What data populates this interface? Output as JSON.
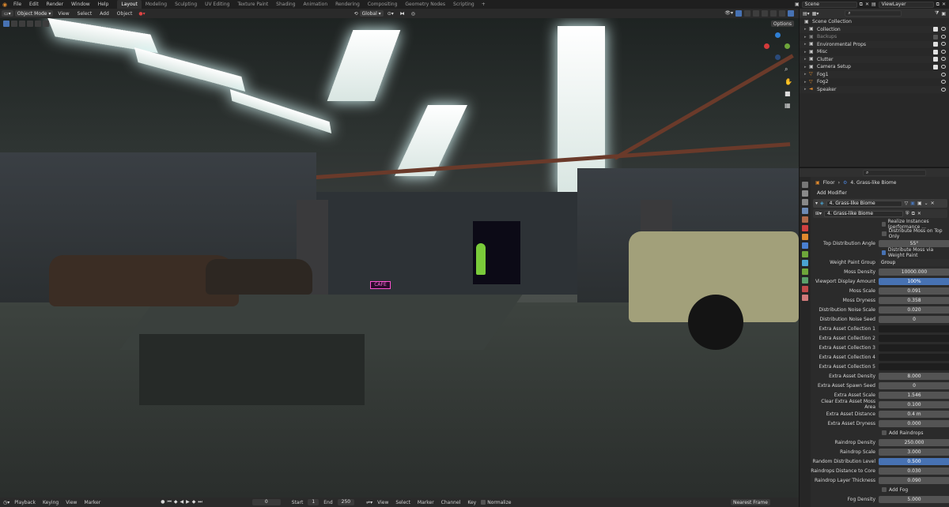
{
  "menu": {
    "items": [
      "File",
      "Edit",
      "Render",
      "Window",
      "Help"
    ],
    "workspaces": [
      "Layout",
      "Modeling",
      "Sculpting",
      "UV Editing",
      "Texture Paint",
      "Shading",
      "Animation",
      "Rendering",
      "Compositing",
      "Geometry Nodes",
      "Scripting"
    ],
    "active_workspace": "Layout",
    "plus": "+",
    "scene": "Scene",
    "view_layer": "ViewLayer"
  },
  "viewport_header": {
    "mode": "Object Mode",
    "items": [
      "View",
      "Select",
      "Add",
      "Object"
    ],
    "transform": "Global",
    "options": "Options"
  },
  "timeline": {
    "items": [
      "Playback",
      "Keying",
      "View",
      "Marker"
    ],
    "current_frame": "0",
    "start_label": "Start",
    "start": "1",
    "end_label": "End",
    "end": "250",
    "dopesheet_items": [
      "View",
      "Select",
      "Marker",
      "Channel",
      "Key"
    ],
    "normalize": "Normalize",
    "interp": "Nearest Frame"
  },
  "outliner": {
    "rows": [
      {
        "label": "Scene Collection",
        "icon": "collection-icon",
        "color": "#cccccc"
      },
      {
        "label": "Collection",
        "icon": "collection-icon",
        "color": "#cccccc"
      },
      {
        "label": "Backups",
        "icon": "collection-icon",
        "color": "#cccccc",
        "dim": true
      },
      {
        "label": "Environmental Props",
        "icon": "collection-icon",
        "color": "#cccccc"
      },
      {
        "label": "Misc",
        "icon": "collection-icon",
        "color": "#cccccc"
      },
      {
        "label": "Clutter",
        "icon": "collection-icon",
        "color": "#cccccc"
      },
      {
        "label": "Camera Setup",
        "icon": "collection-icon",
        "color": "#cccccc"
      },
      {
        "label": "Fog1",
        "icon": "mesh-icon",
        "color": "#e08a2e"
      },
      {
        "label": "Fog2",
        "icon": "mesh-icon",
        "color": "#e08a2e"
      },
      {
        "label": "Speaker",
        "icon": "speaker-icon",
        "color": "#e08a2e"
      }
    ]
  },
  "properties": {
    "crumb_object": "Floor",
    "crumb_modifier": "4. Grass-like Biome",
    "add_modifier": "Add Modifier",
    "modifier_name": "4. Grass-like Biome",
    "node_group": "4. Grass-like Biome",
    "checks": [
      {
        "label": "Realize Instances (performance ...",
        "on": false
      },
      {
        "label": "Distribute Moss on Top Only",
        "on": false
      }
    ],
    "top_distribution": {
      "label": "Top Distribution Angle",
      "value": "55°"
    },
    "weight_check": {
      "label": "Distribute Moss via Weight Paint",
      "on": true
    },
    "weight_group": {
      "label": "Weight Paint Group",
      "value": "Group"
    },
    "fields": [
      {
        "label": "Moss Density",
        "value": "10000.000",
        "style": ""
      },
      {
        "label": "Viewport Display Amount",
        "value": "100%",
        "style": "blue"
      },
      {
        "label": "Moss Scale",
        "value": "0.091",
        "style": ""
      },
      {
        "label": "Moss Dryness",
        "value": "0.358",
        "style": ""
      },
      {
        "label": "Distribution Noise Scale",
        "value": "0.020",
        "style": ""
      },
      {
        "label": "Distribution Noise Seed",
        "value": "0",
        "style": ""
      },
      {
        "label": "Extra Asset Collection 1",
        "value": "",
        "style": "dark"
      },
      {
        "label": "Extra Asset Collection 2",
        "value": "",
        "style": "dark"
      },
      {
        "label": "Extra Asset Collection 3",
        "value": "",
        "style": "dark"
      },
      {
        "label": "Extra Asset Collection 4",
        "value": "",
        "style": "dark"
      },
      {
        "label": "Extra Asset Collection 5",
        "value": "",
        "style": "dark"
      },
      {
        "label": "Extra Asset Density",
        "value": "8.000",
        "style": ""
      },
      {
        "label": "Extra Asset Spawn Seed",
        "value": "0",
        "style": ""
      },
      {
        "label": "Extra Asset Scale",
        "value": "1.546",
        "style": ""
      },
      {
        "label": "Clear Extra Asset Moss Area",
        "value": "0.100",
        "style": ""
      },
      {
        "label": "Extra Asset Distance",
        "value": "0.4 m",
        "style": ""
      },
      {
        "label": "Extra Asset Dryness",
        "value": "0.000",
        "style": ""
      }
    ],
    "raindrops_check": {
      "label": "Add Raindrops",
      "on": false
    },
    "rain_fields": [
      {
        "label": "Raindrop Density",
        "value": "250.000",
        "style": ""
      },
      {
        "label": "Raindrop Scale",
        "value": "3.000",
        "style": ""
      },
      {
        "label": "Random Distribution Level",
        "value": "0.500",
        "style": "blue"
      },
      {
        "label": "Raindrops Distance to Core",
        "value": "0.030",
        "style": ""
      },
      {
        "label": "Raindrop Layer Thickness",
        "value": "0.090",
        "style": ""
      }
    ],
    "fog_check": {
      "label": "Add Fog",
      "on": false
    },
    "fog_density": {
      "label": "Fog Density",
      "value": "5.000"
    }
  },
  "scene": {
    "sign_text": "CAFE"
  }
}
